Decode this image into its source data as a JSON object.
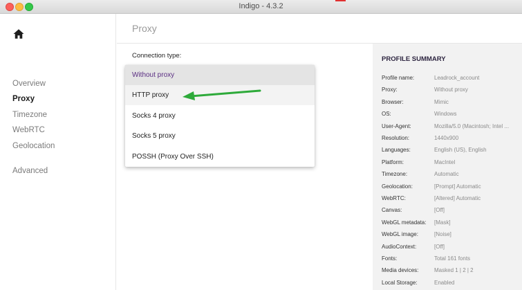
{
  "window": {
    "title": "Indigo - 4.3.2"
  },
  "sidebar": {
    "home_icon": "home-icon",
    "items": [
      {
        "label": "Overview",
        "active": false
      },
      {
        "label": "Proxy",
        "active": true
      },
      {
        "label": "Timezone",
        "active": false
      },
      {
        "label": "WebRTC",
        "active": false
      },
      {
        "label": "Geolocation",
        "active": false
      },
      {
        "label": "Advanced",
        "active": false
      }
    ]
  },
  "header": {
    "title": "Proxy"
  },
  "connection": {
    "label": "Connection type:",
    "options": [
      "Without proxy",
      "HTTP proxy",
      "Socks 4 proxy",
      "Socks 5 proxy",
      "POSSH (Proxy Over SSH)"
    ],
    "selected": "Without proxy",
    "highlighted": "HTTP proxy"
  },
  "annotation": {
    "arrow_color": "#2eaa3a",
    "arrow_icon": "arrow-left-icon"
  },
  "summary": {
    "title": "PROFILE SUMMARY",
    "rows": [
      {
        "key": "Profile name:",
        "value": "Leadrock_account"
      },
      {
        "key": "Proxy:",
        "value": "Without proxy"
      },
      {
        "key": "Browser:",
        "value": "Mimic"
      },
      {
        "key": "OS:",
        "value": "Windows"
      },
      {
        "key": "User-Agent:",
        "value": "Mozilla/5.0 (Macintosh; Intel ..."
      },
      {
        "key": "Resolution:",
        "value": "1440x900"
      },
      {
        "key": "Languages:",
        "value": "English (US), English"
      },
      {
        "key": "Platform:",
        "value": "MacIntel"
      },
      {
        "key": "Timezone:",
        "value": "Automatic"
      },
      {
        "key": "Geolocation:",
        "value": "[Prompt] Automatic"
      },
      {
        "key": "WebRTC:",
        "value": "[Altered] Automatic"
      },
      {
        "key": "Canvas:",
        "value": "[Off]"
      },
      {
        "key": "WebGL metadata:",
        "value": "[Mask]"
      },
      {
        "key": "WebGL image:",
        "value": "[Noise]"
      },
      {
        "key": "AudioContext:",
        "value": "[Off]"
      },
      {
        "key": "Fonts:",
        "value": "Total 161 fonts"
      },
      {
        "key": "Media devices:",
        "value": "Masked 1 | 2 | 2"
      },
      {
        "key": "Local Storage:",
        "value": "Enabled"
      }
    ]
  },
  "colors": {
    "accent": "#5a2d82",
    "sidebar_active": "#1a1a1a",
    "summary_bg": "#f2f2f2"
  }
}
